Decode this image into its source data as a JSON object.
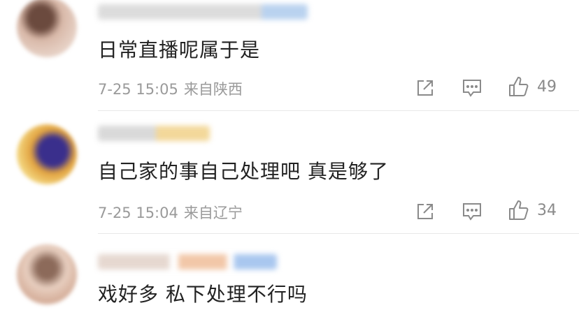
{
  "comments": [
    {
      "text": "日常直播呢属于是",
      "time": "7-25 15:05",
      "location": "来自陕西",
      "likes": "49",
      "avatar_colors": [
        "#6b4a3e",
        "#d8b8a8",
        "#e6d0c4"
      ],
      "name_blur_colors": [
        "#dcdcdc",
        "#b9d2ef"
      ]
    },
    {
      "text": "自己家的事自己处理吧 真是够了",
      "time": "7-25 15:04",
      "location": "来自辽宁",
      "likes": "34",
      "avatar_colors": [
        "#3a2f8c",
        "#e2a340",
        "#f2d27a"
      ],
      "name_blur_colors": [
        "#d9d9d9",
        "#f3d89a"
      ]
    },
    {
      "text": "戏好多 私下处理不行吗",
      "avatar_colors": [
        "#8c6a5a",
        "#e8cfc0",
        "#d6b09c"
      ],
      "name_blur_colors": [
        "#e6d8d0",
        "#f2c7a8",
        "#a9c7ef"
      ]
    }
  ]
}
